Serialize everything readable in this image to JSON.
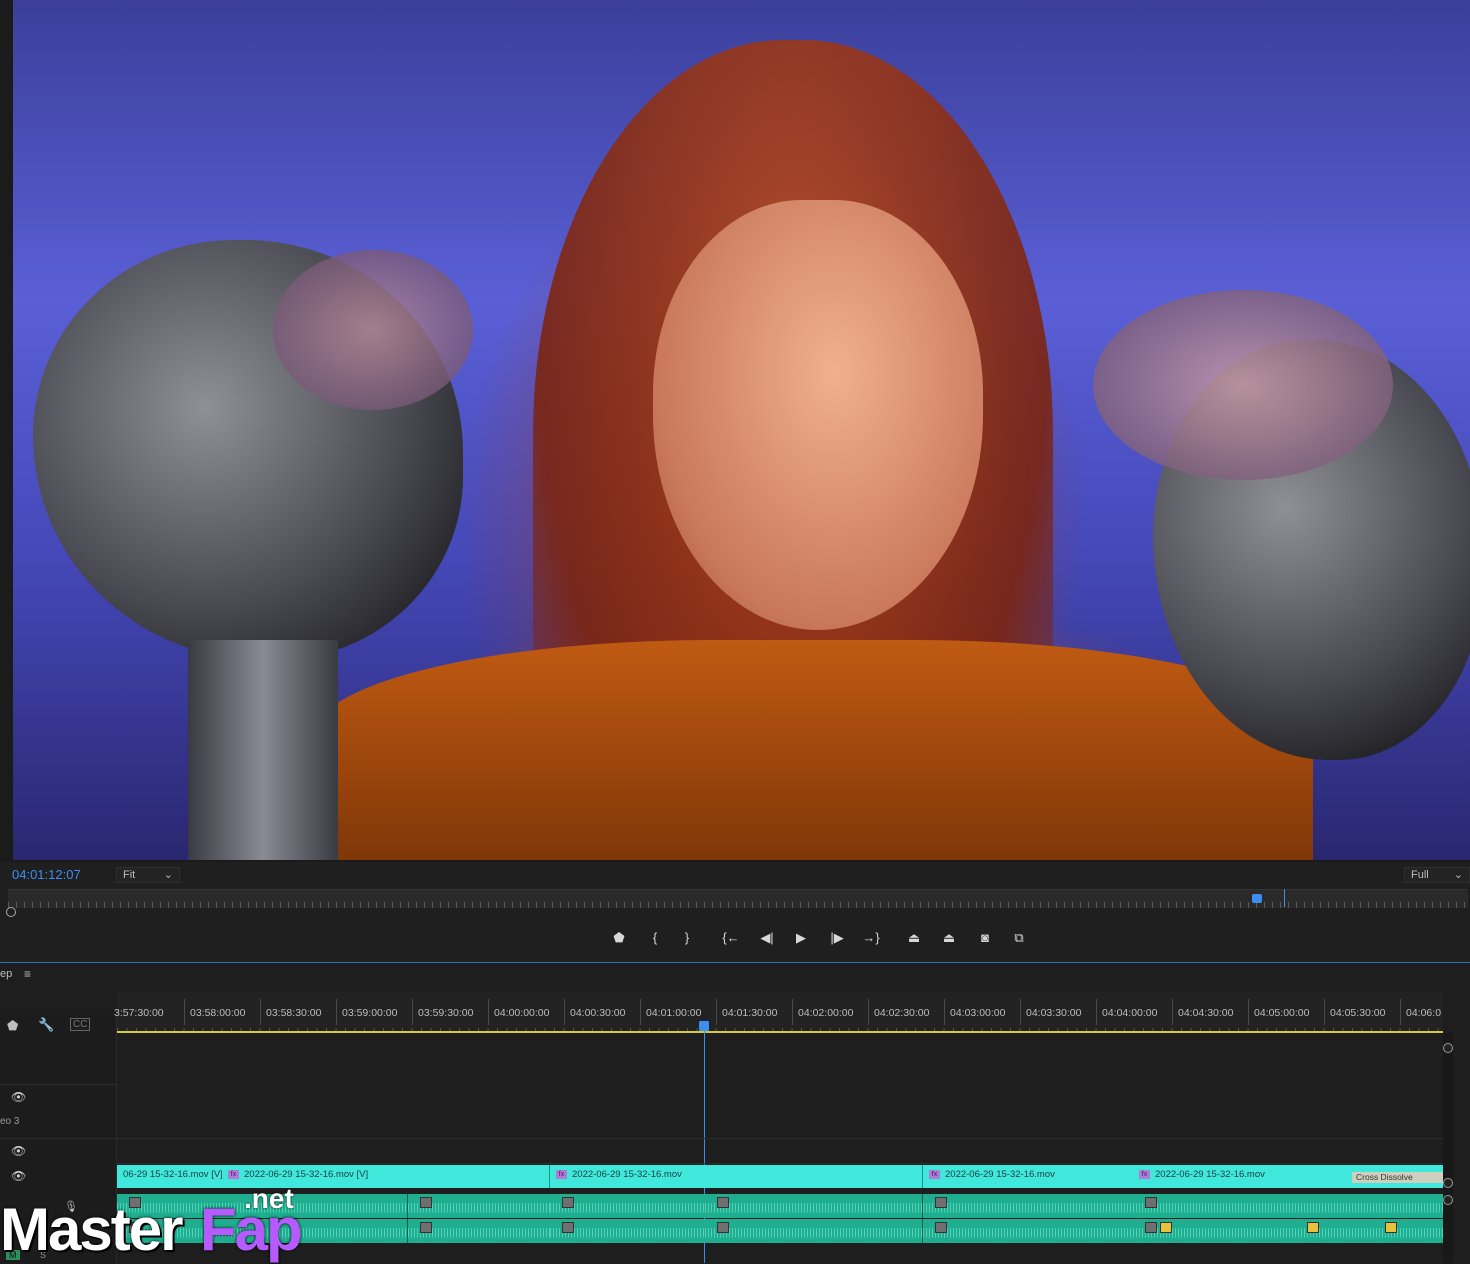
{
  "viewer": {
    "timecode": "04:01:12:07",
    "zoom": "Fit",
    "resolution": "Full",
    "playhead_fraction": 0.875
  },
  "transport": [
    {
      "name": "add-marker-button",
      "glyph": "⬟"
    },
    {
      "name": "mark-in-button",
      "glyph": "{"
    },
    {
      "name": "mark-out-button",
      "glyph": "}"
    },
    {
      "name": "go-to-in-button",
      "glyph": "{←"
    },
    {
      "name": "step-back-button",
      "glyph": "◀|"
    },
    {
      "name": "play-button",
      "glyph": "▶"
    },
    {
      "name": "step-forward-button",
      "glyph": "|▶"
    },
    {
      "name": "go-to-out-button",
      "glyph": "→}"
    },
    {
      "name": "lift-button",
      "glyph": "⏏"
    },
    {
      "name": "extract-button",
      "glyph": "⏏"
    },
    {
      "name": "export-frame-button",
      "glyph": "📷"
    },
    {
      "name": "comparison-view-button",
      "glyph": "⧉"
    }
  ],
  "timeline": {
    "sequence_tab": "ep",
    "ruler_labels": [
      "3:57:30:00",
      "03:58:00:00",
      "03:58:30:00",
      "03:59:00:00",
      "03:59:30:00",
      "04:00:00:00",
      "04:00:30:00",
      "04:01:00:00",
      "04:01:30:00",
      "04:02:00:00",
      "04:02:30:00",
      "04:03:00:00",
      "04:03:30:00",
      "04:04:00:00",
      "04:04:30:00",
      "04:05:00:00",
      "04:05:30:00",
      "04:06:0"
    ],
    "track_label": "eo 3",
    "video_clips": [
      {
        "label": "06-29 15-32-16.mov [V]",
        "fx": false
      },
      {
        "label": "2022-06-29 15-32-16.mov [V]",
        "fx": true
      },
      {
        "label": "2022-06-29 15-32-16.mov",
        "fx": true
      },
      {
        "label": "",
        "fx": false
      },
      {
        "label": "2022-06-29 15-32-16.mov",
        "fx": true
      },
      {
        "label": "2022-06-29 15-32-16.mov",
        "fx": true
      }
    ],
    "transition": "Cross Dissolve",
    "track_buttons": {
      "mute": "M",
      "solo": "S"
    }
  },
  "watermark": {
    "master": "Master",
    "fap": "Fap",
    "net": ".net"
  },
  "colors": {
    "accent": "#3d8ef2",
    "video_clip": "#40e8dc",
    "audio_clip": "#1fae8f",
    "work_area": "#d6c940"
  }
}
